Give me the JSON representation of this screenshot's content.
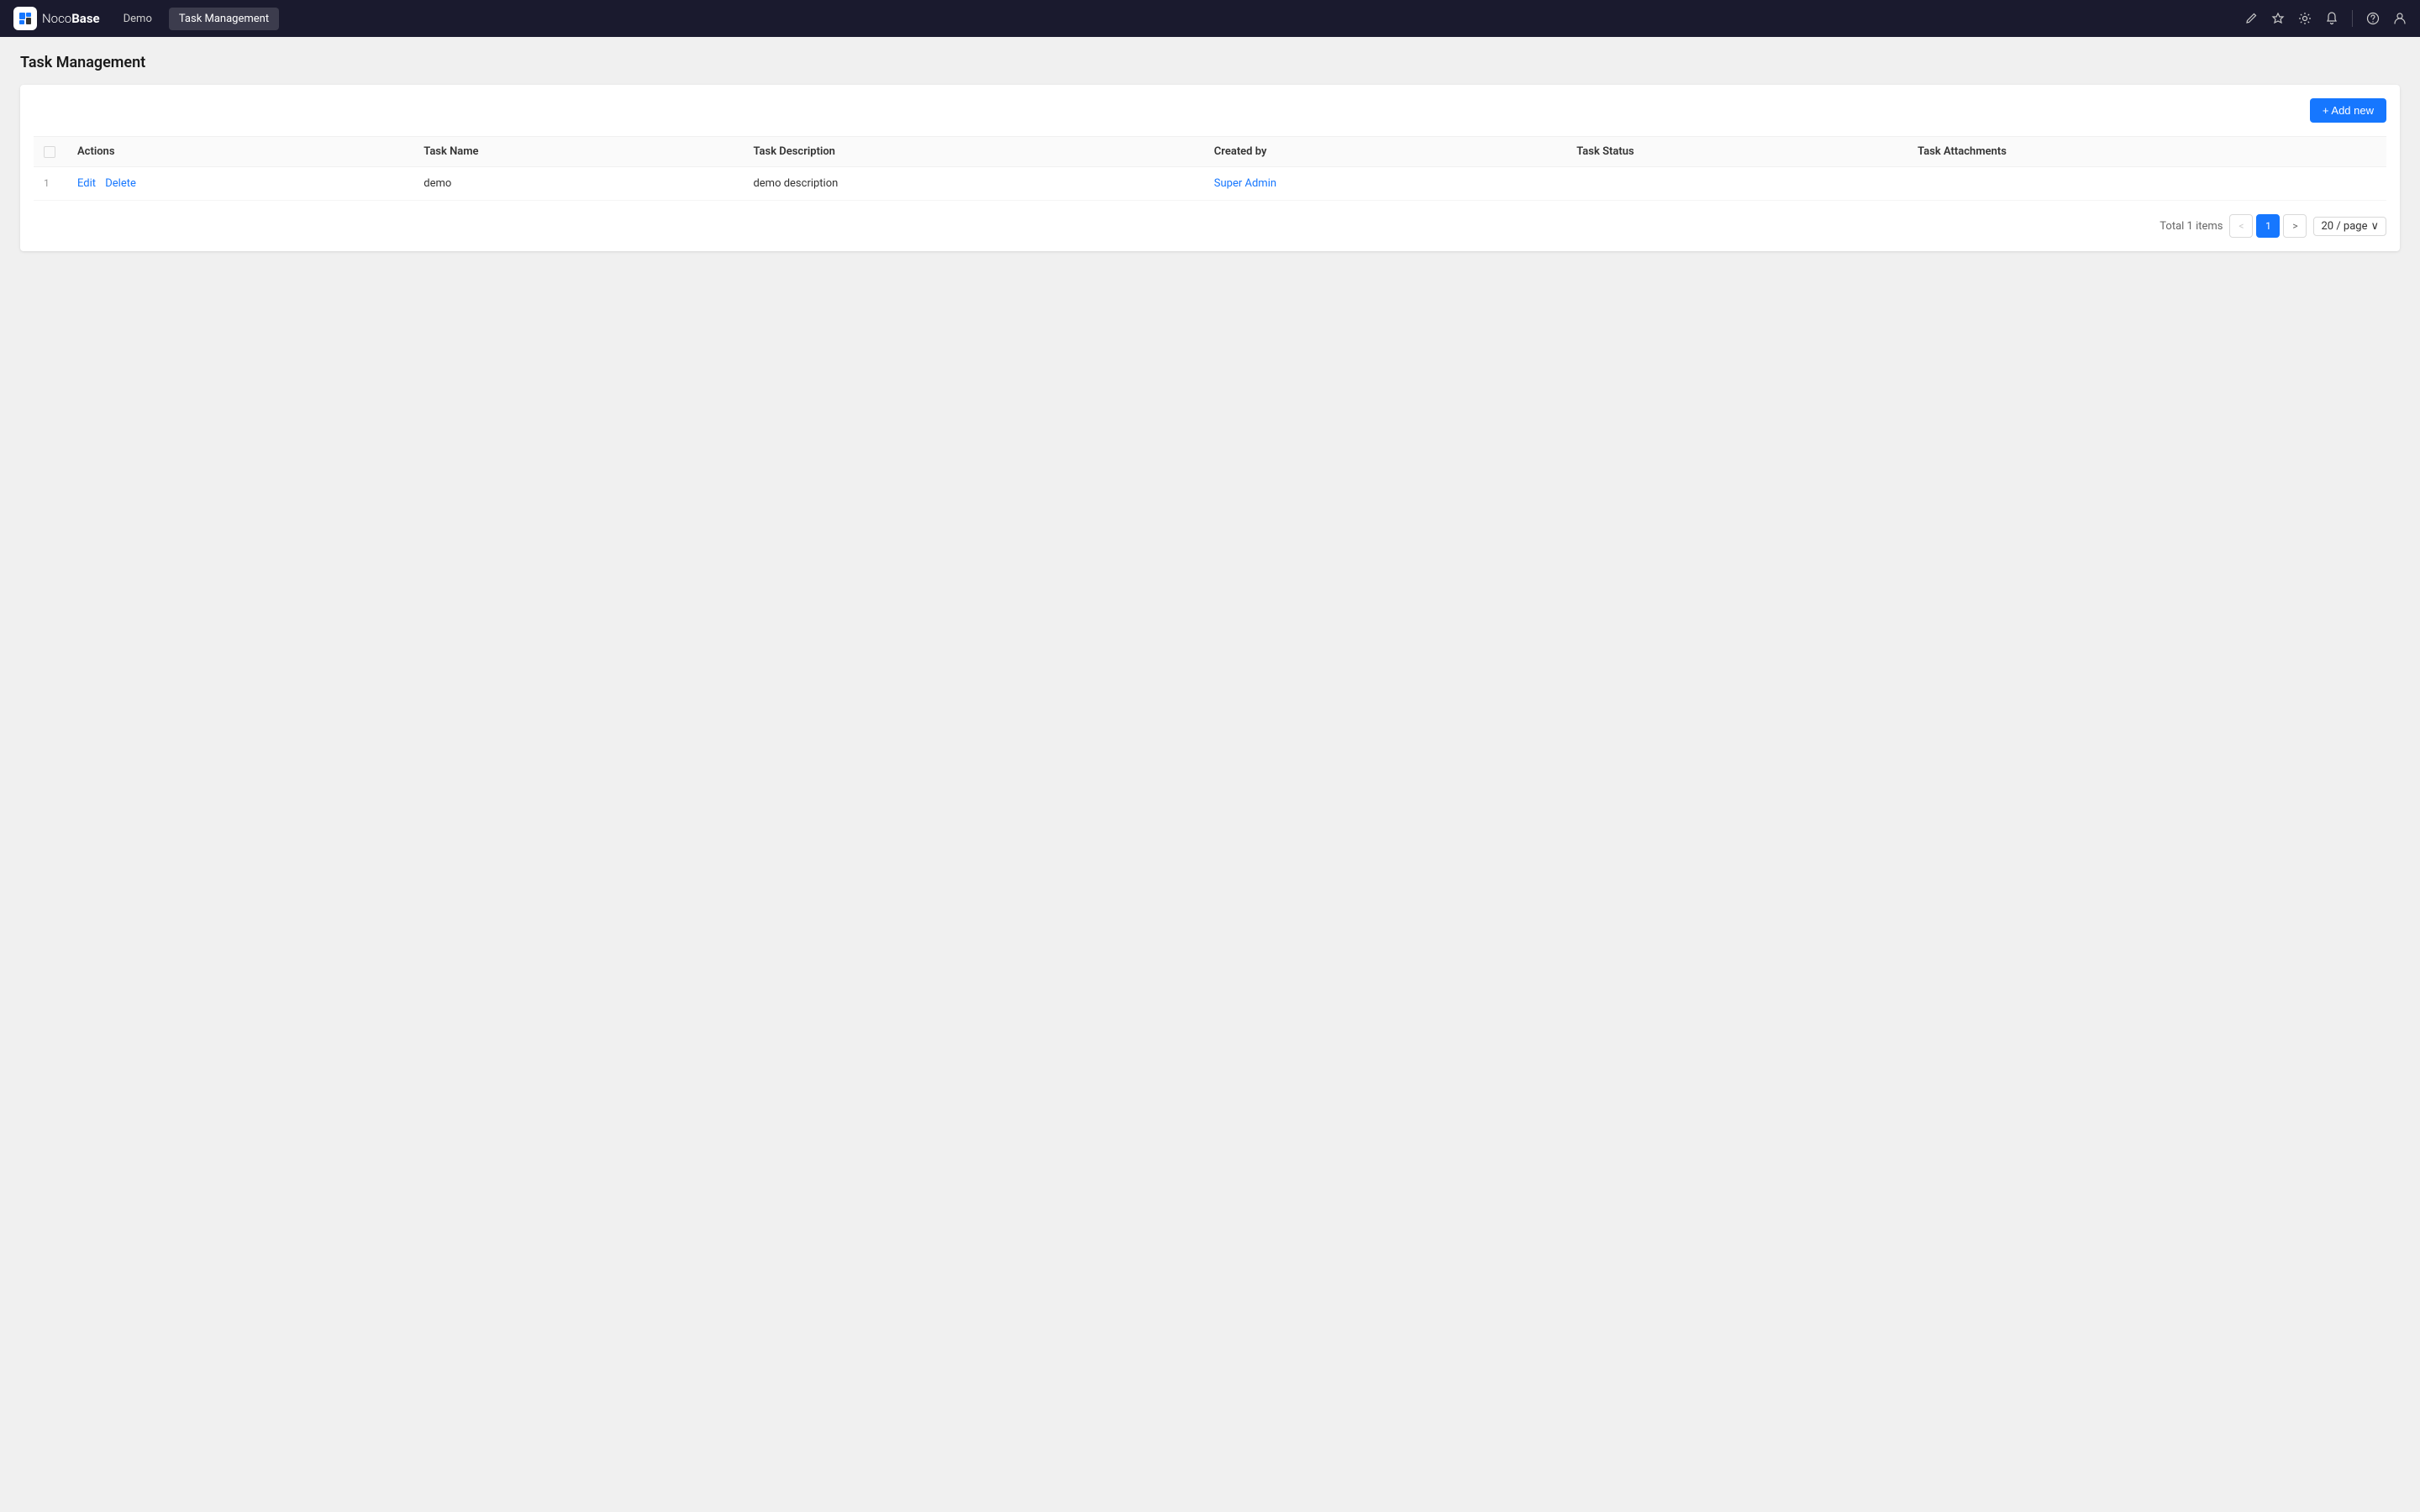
{
  "app": {
    "name": "NocoBase",
    "logo_text_noco": "Noco",
    "logo_text_base": "Base"
  },
  "navbar": {
    "demo_label": "Demo",
    "task_management_label": "Task Management",
    "icons": {
      "pencil": "✏",
      "pin": "📌",
      "settings": "⚙",
      "bell": "🔔",
      "help": "?",
      "user": "👤"
    }
  },
  "page": {
    "title": "Task Management"
  },
  "toolbar": {
    "add_new_label": "+ Add new"
  },
  "table": {
    "columns": [
      {
        "key": "actions",
        "label": "Actions"
      },
      {
        "key": "task_name",
        "label": "Task Name"
      },
      {
        "key": "task_description",
        "label": "Task Description"
      },
      {
        "key": "created_by",
        "label": "Created by"
      },
      {
        "key": "task_status",
        "label": "Task Status"
      },
      {
        "key": "task_attachments",
        "label": "Task Attachments"
      }
    ],
    "rows": [
      {
        "index": 1,
        "task_name": "demo",
        "task_description": "demo description",
        "created_by": "Super Admin",
        "task_status": "",
        "task_attachments": ""
      }
    ]
  },
  "pagination": {
    "total_label": "Total 1 items",
    "current_page": 1,
    "prev_icon": "<",
    "next_icon": ">",
    "page_size_label": "20 / page",
    "chevron_down": "∨"
  }
}
